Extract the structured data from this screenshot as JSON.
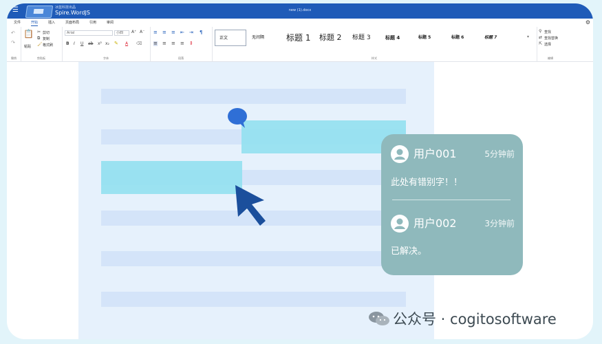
{
  "app": {
    "subtitle": "冰蓝科技出品",
    "name": "Spire.WordJS",
    "doc_title": "new (1).docx"
  },
  "tabs": [
    {
      "label": "文件"
    },
    {
      "label": "开始"
    },
    {
      "label": "插入"
    },
    {
      "label": "页面布局"
    },
    {
      "label": "引用"
    },
    {
      "label": "审阅"
    }
  ],
  "ribbon": {
    "clipboard": {
      "undo_label": "撤销",
      "paste_label": "粘贴",
      "cut_label": "剪切",
      "copy_label": "复制",
      "format_painter_label": "格式刷",
      "group_label": "剪贴板"
    },
    "font": {
      "font_name": "Arial",
      "font_size": "小四",
      "group_label": "字体"
    },
    "paragraph": {
      "group_label": "段落"
    },
    "styles": {
      "items": [
        {
          "label": "正文"
        },
        {
          "label": "无间隔"
        },
        {
          "label": "标题 1"
        },
        {
          "label": "标题 2"
        },
        {
          "label": "标题 3"
        },
        {
          "label": "标题 4"
        },
        {
          "label": "标题 5"
        },
        {
          "label": "标题 6"
        },
        {
          "label": "标题 7"
        }
      ],
      "group_label": "样式"
    },
    "editing": {
      "find_label": "查找",
      "find_replace_label": "查找替换",
      "select_label": "选择",
      "group_label": "编辑"
    }
  },
  "comments": [
    {
      "user": "用户001",
      "time": "5分钟前",
      "text": "此处有错别字！！"
    },
    {
      "user": "用户002",
      "time": "3分钟前",
      "text": "已解决。"
    }
  ],
  "watermark": {
    "text": "公众号 · cogitosoftware"
  },
  "colors": {
    "titlebar": "#1f5bb8",
    "background": "#e2f4fa",
    "page": "#e6f1fc",
    "text_line": "#d4e4f9",
    "highlight": "#92e0f0",
    "comment_panel": "#8fb9bc",
    "bubble": "#2f6fd6",
    "cursor": "#1b4f9c"
  }
}
